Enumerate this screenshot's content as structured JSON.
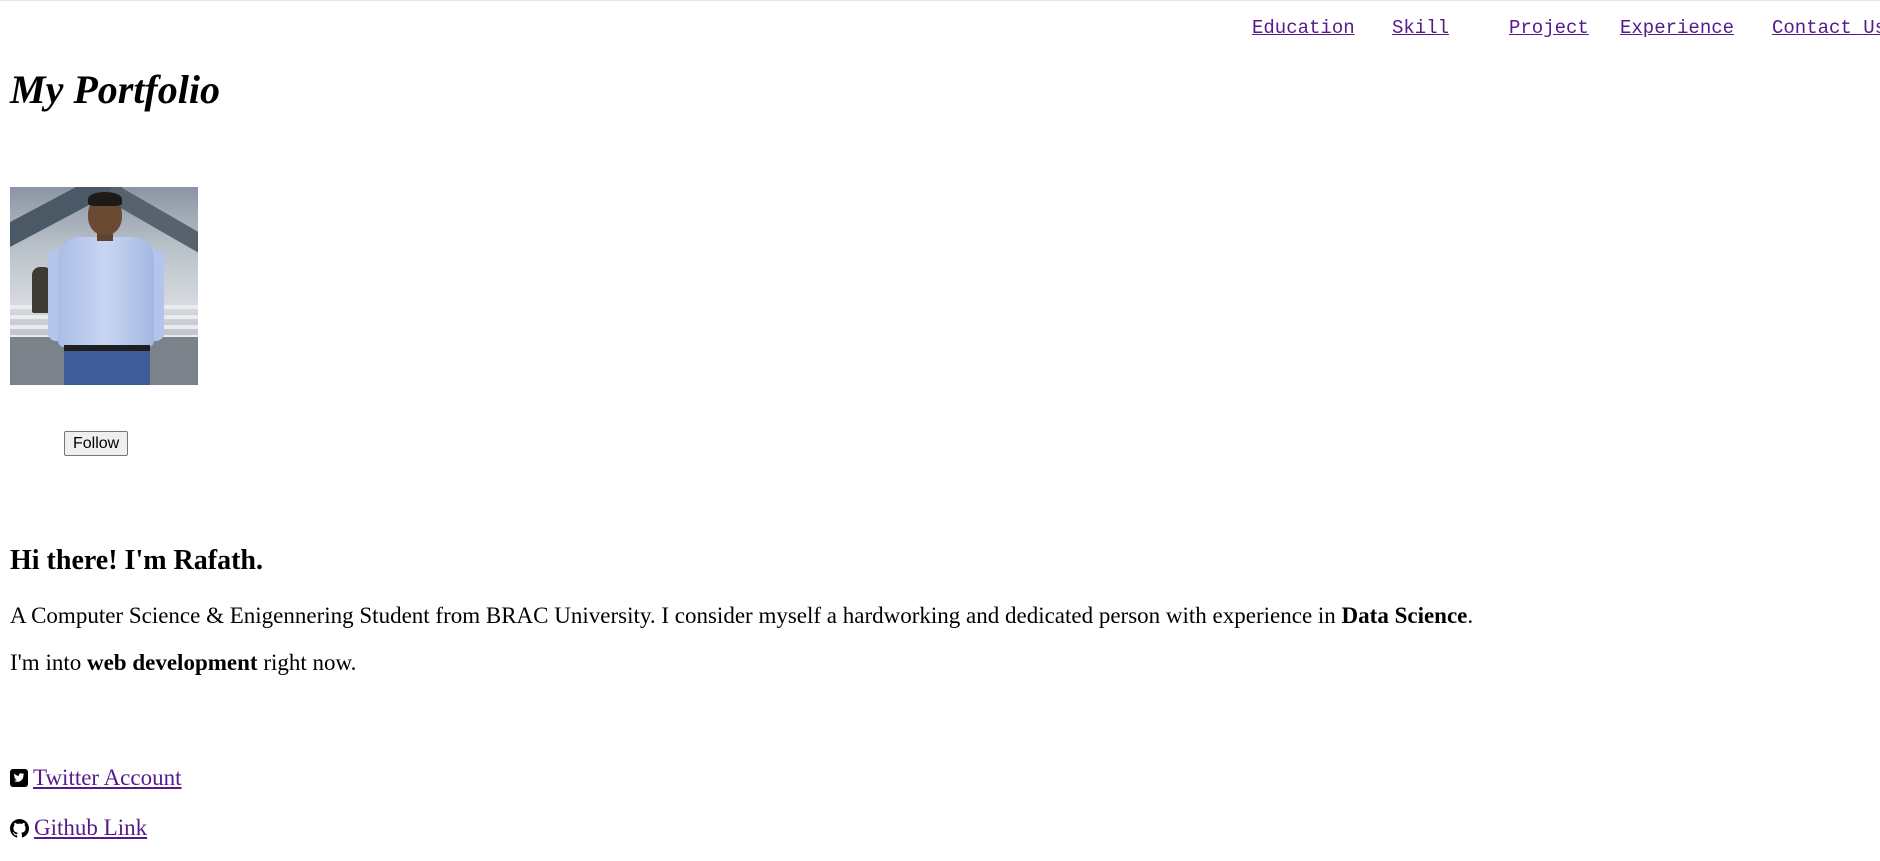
{
  "nav": {
    "items": [
      {
        "label": "Education"
      },
      {
        "label": "Skill"
      },
      {
        "label": "Project"
      },
      {
        "label": "Experience"
      },
      {
        "label": "Contact Us"
      }
    ],
    "link_color": "#551a8b"
  },
  "header": {
    "title": "My Portfolio"
  },
  "profile": {
    "photo_icon": "profile-photo",
    "follow_label": "Follow"
  },
  "intro": {
    "greeting": "Hi there! I'm Rafath.",
    "bio_1_before": "A Computer Science & Enigennering Student from BRAC University. I consider myself a hardworking and dedicated person with experience in ",
    "bio_1_bold": "Data Science",
    "bio_1_after": ".",
    "bio_2_before": "I'm into ",
    "bio_2_bold": "web development",
    "bio_2_after": " right now."
  },
  "social": {
    "twitter": {
      "icon": "twitter-square-icon",
      "label": "Twitter Account"
    },
    "github": {
      "icon": "github-icon",
      "label": "Github Link"
    }
  }
}
